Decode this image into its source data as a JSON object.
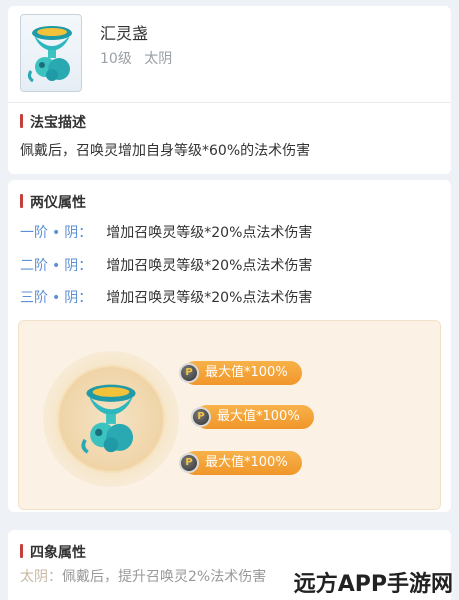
{
  "item": {
    "name": "汇灵盏",
    "level": "10级",
    "element": "太阴"
  },
  "sections": {
    "description": {
      "title": "法宝描述",
      "text": "佩戴后，召唤灵增加自身等级*60%的法术伤害"
    },
    "liangyi": {
      "title": "两仪属性",
      "rows": [
        {
          "tier": "一阶",
          "sep": "•",
          "yin": "阴：",
          "value": "增加召唤灵等级*20%点法术伤害"
        },
        {
          "tier": "二阶",
          "sep": "•",
          "yin": "阴：",
          "value": "增加召唤灵等级*20%点法术伤害"
        },
        {
          "tier": "三阶",
          "sep": "•",
          "yin": "阴：",
          "value": "增加召唤灵等级*20%点法术伤害"
        }
      ],
      "bonuses": [
        {
          "label": "最大值*100%",
          "coin": "P"
        },
        {
          "label": "最大值*100%",
          "coin": "P"
        },
        {
          "label": "最大值*100%",
          "coin": "P"
        }
      ]
    },
    "sixiang": {
      "title": "四象属性",
      "row": {
        "tier": "太阴：",
        "value": "佩戴后，提升召唤灵2%法术伤害"
      }
    }
  },
  "watermark": "远方APP手游网",
  "colors": {
    "accent_bar": "#c4413b",
    "tier_blue": "#5b8fd6",
    "pill_orange": "#f0962a",
    "panel_bg": "#fbf2e5"
  },
  "icons": {
    "item": "jade-cup-icon",
    "coin": "coin-icon"
  }
}
